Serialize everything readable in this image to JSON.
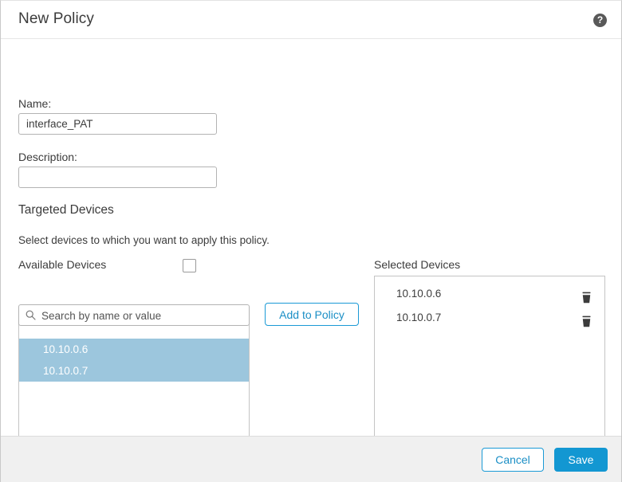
{
  "header": {
    "title": "New Policy",
    "help_icon": "question-mark-icon",
    "help_glyph": "?"
  },
  "form": {
    "name_label": "Name:",
    "name_value": "interface_PAT",
    "name_placeholder": "",
    "description_label": "Description:",
    "description_value": "",
    "description_placeholder": ""
  },
  "targeted_devices": {
    "heading": "Targeted Devices",
    "instruction": "Select devices to which you want to apply this policy.",
    "available": {
      "label": "Available Devices",
      "select_all_checked": false,
      "search_placeholder": "Search by name or value",
      "search_value": "",
      "search_icon": "search-icon",
      "items": [
        {
          "label": "10.10.0.6",
          "selected": true
        },
        {
          "label": "10.10.0.7",
          "selected": true
        }
      ]
    },
    "add_button_label": "Add to Policy",
    "selected": {
      "label": "Selected Devices",
      "items": [
        {
          "label": "10.10.0.6",
          "delete_icon": "trash-icon"
        },
        {
          "label": "10.10.0.7",
          "delete_icon": "trash-icon"
        }
      ]
    }
  },
  "footer": {
    "cancel_label": "Cancel",
    "save_label": "Save"
  },
  "colors": {
    "accent_blue": "#1397d2",
    "selection_blue": "#9cc6dd",
    "footer_gray": "#f0f0f0",
    "text": "#3c3c3c"
  }
}
